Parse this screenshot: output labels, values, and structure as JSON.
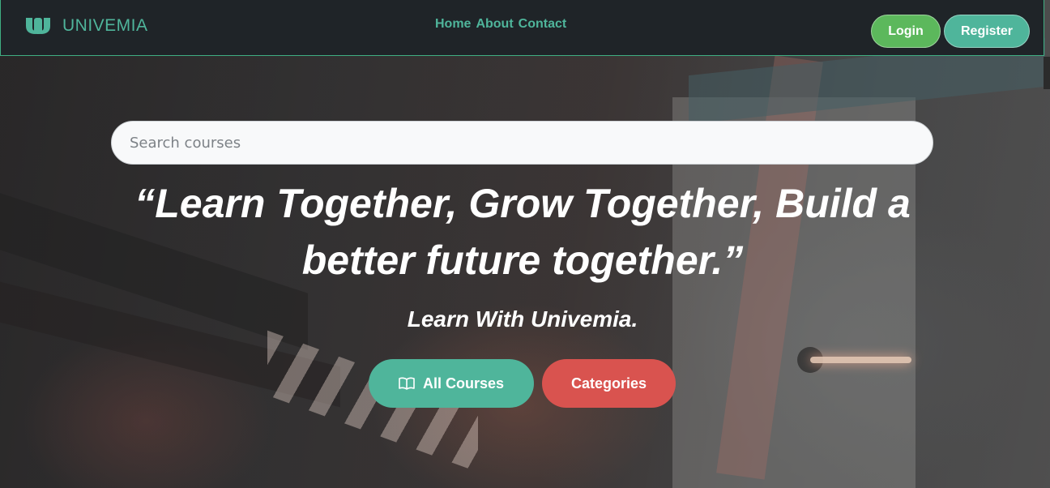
{
  "navbar": {
    "brand_name": "UNIVEMIA",
    "brand_icon": "univemia-logo-icon",
    "links": [
      {
        "label": "Home"
      },
      {
        "label": "About"
      },
      {
        "label": "Contact"
      }
    ],
    "login_label": "Login",
    "register_label": "Register"
  },
  "hero": {
    "search": {
      "placeholder": "Search courses",
      "value": ""
    },
    "headline": "“Learn Together, Grow Together, Build a better future together.”",
    "subhead": "Learn With Univemia.",
    "all_courses_label": "All Courses",
    "all_courses_icon": "book-icon",
    "categories_label": "Categories"
  },
  "colors": {
    "accent_teal": "#4fb59b",
    "login_green": "#5cb85c",
    "categories_red": "#d9534f",
    "navbar_bg": "#1f2428"
  }
}
